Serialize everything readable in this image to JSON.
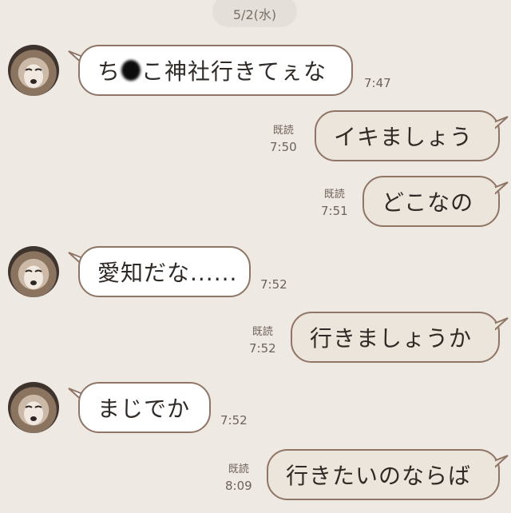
{
  "date_label": "5/2(水)",
  "read_label": "既読",
  "messages": [
    {
      "side": "in",
      "text_a": "ち",
      "text_b": "こ神社行きてぇな",
      "time": "7:47"
    },
    {
      "side": "out",
      "text": "イキましょう",
      "time": "7:50"
    },
    {
      "side": "out",
      "text": "どこなの",
      "time": "7:51"
    },
    {
      "side": "in",
      "text": "愛知だな......",
      "time": "7:52"
    },
    {
      "side": "out",
      "text": "行きましょうか",
      "time": "7:52"
    },
    {
      "side": "in",
      "text": "まじでか",
      "time": "7:52"
    },
    {
      "side": "out",
      "text": "行きたいのならば",
      "time": "8:09"
    }
  ],
  "colors": {
    "background": "#efe9e3",
    "incoming_bubble": "#ffffff",
    "outgoing_bubble": "#ece5dc",
    "bubble_border": "#8f7566"
  },
  "icons": {
    "avatar": "fox-avatar-icon"
  }
}
